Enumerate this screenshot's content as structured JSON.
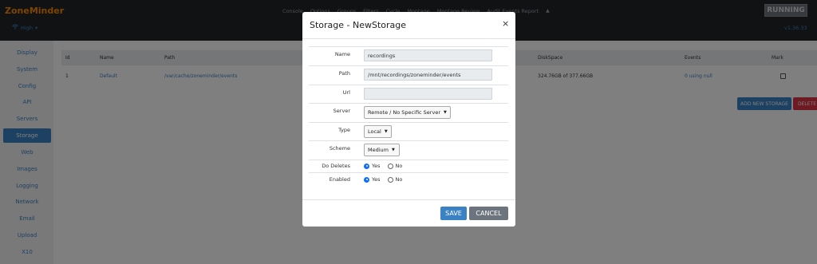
{
  "header": {
    "brand": "ZoneMinder",
    "nav": [
      "Console",
      "Options",
      "Groups",
      "Filters",
      "Cycle",
      "Montage",
      "Montage Review",
      "Audit Events Report"
    ],
    "status": "RUNNING",
    "bandwidth": "High",
    "version": "v1.36.33"
  },
  "sidebar": {
    "items": [
      "Display",
      "System",
      "Config",
      "API",
      "Servers",
      "Storage",
      "Web",
      "Images",
      "Logging",
      "Network",
      "Email",
      "Upload",
      "X10"
    ],
    "active": "Storage"
  },
  "table": {
    "headers": [
      "Id",
      "Name",
      "Path",
      "DiskSpace",
      "Events",
      "Mark"
    ],
    "rows": [
      {
        "id": "1",
        "name": "Default",
        "path": "/var/cache/zoneminder/events",
        "diskspace": "324.76GB of 377.66GB",
        "events": "0 using null"
      }
    ],
    "add_label": "ADD NEW STORAGE",
    "delete_label": "DELETE"
  },
  "modal": {
    "title": "Storage - NewStorage",
    "close": "×",
    "fields": {
      "name": {
        "label": "Name",
        "value": "recordings"
      },
      "path": {
        "label": "Path",
        "value": "/mnt/recordings/zoneminder/events"
      },
      "url": {
        "label": "Url",
        "value": ""
      },
      "server": {
        "label": "Server",
        "value": "Remote / No Specific Server"
      },
      "type": {
        "label": "Type",
        "value": "Local"
      },
      "scheme": {
        "label": "Scheme",
        "value": "Medium"
      },
      "do_deletes": {
        "label": "Do Deletes",
        "yes": "Yes",
        "no": "No",
        "selected": "Yes"
      },
      "enabled": {
        "label": "Enabled",
        "yes": "Yes",
        "no": "No",
        "selected": "Yes"
      }
    },
    "save": "SAVE",
    "cancel": "CANCEL"
  }
}
